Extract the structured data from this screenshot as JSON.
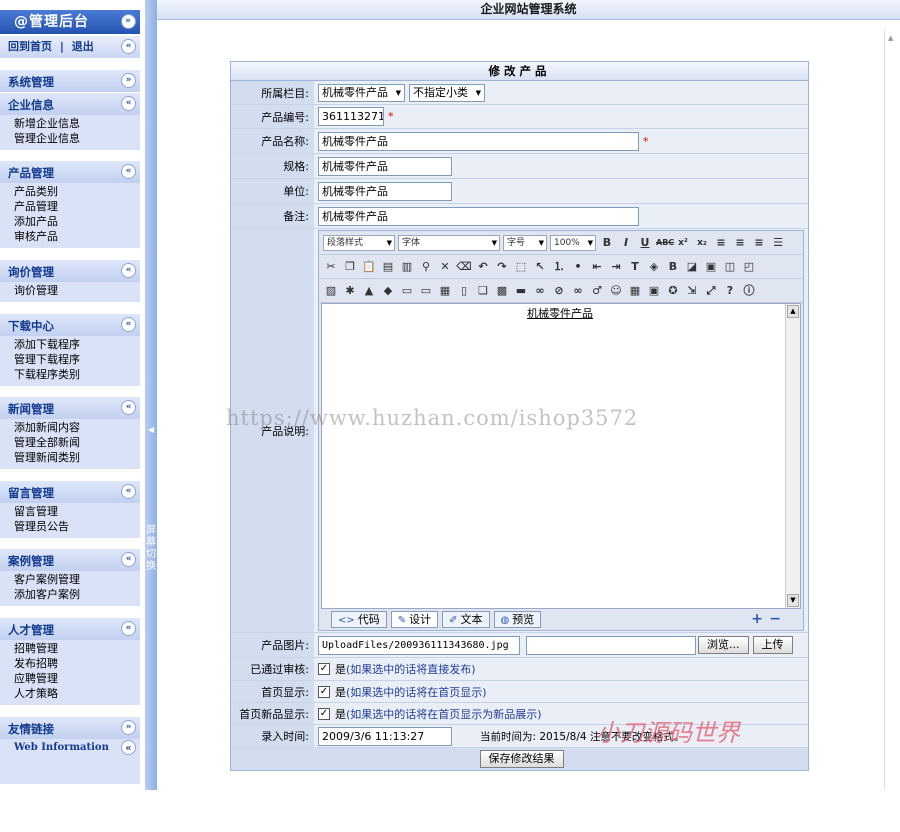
{
  "app": {
    "sidebar_title": "@管理后台",
    "top_title": "企业网站管理系统",
    "home_link": "回到首页",
    "separator": "|",
    "logout_link": "退出",
    "splitter_text": "屏幕切换"
  },
  "sidebar": {
    "sections": [
      {
        "title": "系统管理",
        "toggle": "»",
        "items": []
      },
      {
        "title": "企业信息",
        "toggle": "«",
        "items": [
          "新增企业信息",
          "管理企业信息"
        ]
      },
      {
        "title": "产品管理",
        "toggle": "«",
        "items": [
          "产品类别",
          "产品管理",
          "添加产品",
          "审核产品"
        ]
      },
      {
        "title": "询价管理",
        "toggle": "«",
        "items": [
          "询价管理"
        ]
      },
      {
        "title": "下载中心",
        "toggle": "«",
        "items": [
          "添加下载程序",
          "管理下载程序",
          "下载程序类别"
        ]
      },
      {
        "title": "新闻管理",
        "toggle": "«",
        "items": [
          "添加新闻内容",
          "管理全部新闻",
          "管理新闻类别"
        ]
      },
      {
        "title": "留言管理",
        "toggle": "«",
        "items": [
          "留言管理",
          "管理员公告"
        ]
      },
      {
        "title": "案例管理",
        "toggle": "«",
        "items": [
          "客户案例管理",
          "添加客户案例"
        ]
      },
      {
        "title": "人才管理",
        "toggle": "«",
        "items": [
          "招聘管理",
          "发布招聘",
          "应聘管理",
          "人才策略"
        ]
      },
      {
        "title": "友情链接",
        "toggle": "»",
        "items": [
          "Web Information"
        ]
      }
    ]
  },
  "form": {
    "title": "修改产品",
    "category_label": "所属栏目:",
    "category_value": "机械零件产品",
    "subcategory_value": "不指定小类",
    "code_label": "产品编号:",
    "code_value": "3611132716",
    "name_label": "产品名称:",
    "name_value": "机械零件产品",
    "spec_label": "规格:",
    "spec_value": "机械零件产品",
    "unit_label": "单位:",
    "unit_value": "机械零件产品",
    "remark_label": "备注:",
    "remark_value": "机械零件产品",
    "desc_label": "产品说明:",
    "required_mark": "*",
    "editor": {
      "style_select": "段落样式",
      "font_select": "字体",
      "size_select": "字号",
      "zoom_select": "100%",
      "content": "机械零件产品",
      "tab_code": "代码",
      "tab_design": "设计",
      "tab_text": "文本",
      "tab_preview": "预览"
    },
    "image_label": "产品图片:",
    "image_value": "UploadFiles/200936111343680.jpg",
    "browse_button": "浏览...",
    "upload_button": "上传",
    "approved_label": "已通过审核:",
    "approved_text": "是",
    "approved_hint": "(如果选中的话将直接发布)",
    "home_label": "首页显示:",
    "home_text": "是",
    "home_hint": "(如果选中的话将在首页显示)",
    "new_label": "首页新品显示:",
    "new_text": "是",
    "new_hint": "(如果选中的话将在首页显示为新品展示)",
    "time_label": "录入时间:",
    "time_value": "2009/3/6 11:13:27",
    "time_note": "当前时间为: 2015/8/4 注意不要改变格式。",
    "save_button": "保存修改结果"
  },
  "watermark": "https://www.huzhan.com/ishop3572",
  "brand": "小刀源码世界"
}
